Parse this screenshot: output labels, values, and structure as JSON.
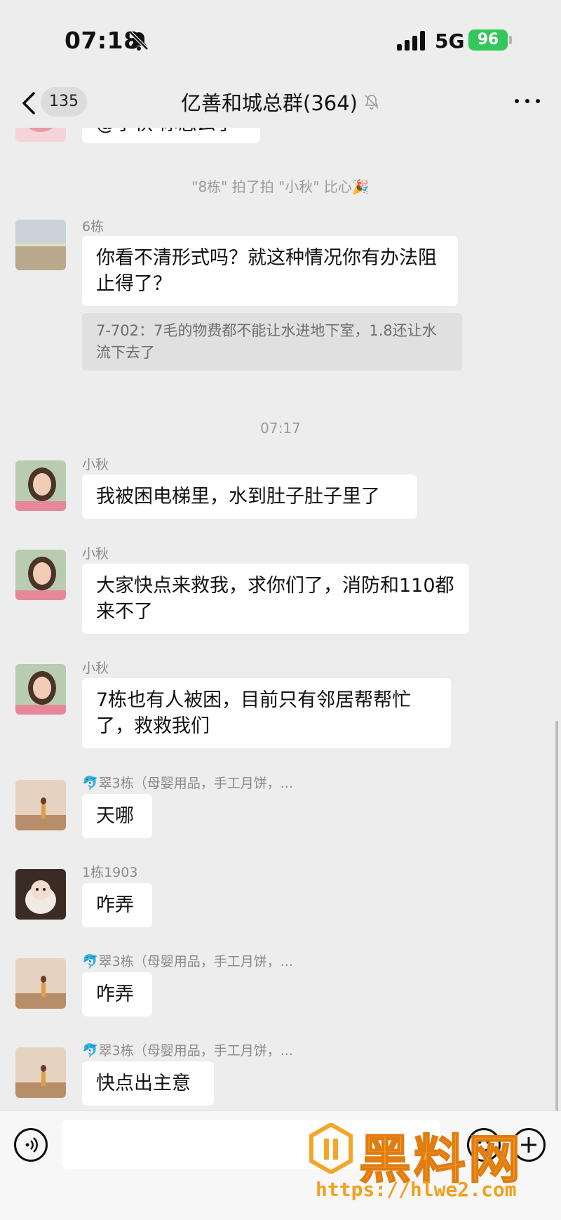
{
  "status_bar": {
    "time": "07:18",
    "network": "5G",
    "battery": "96"
  },
  "nav": {
    "unread_count": "135",
    "title": "亿善和城总群(364)"
  },
  "chat": {
    "partial_message": "@小秋 你怎么了",
    "pat_notice": "\"8栋\" 拍了拍 \"小秋\" 比心🎉",
    "timestamp": "07:17",
    "messages": [
      {
        "sender": "6栋",
        "text": "你看不清形式吗？就这种情况你有办法阻止得了？",
        "quote": "7-702：7毛的物费都不能让水进地下室，1.8还让水流下去了"
      },
      {
        "sender": "小秋",
        "text": "我被困电梯里，水到肚子肚子里了"
      },
      {
        "sender": "小秋",
        "text": "大家快点来救我，求你们了，消防和110都来不了"
      },
      {
        "sender": "小秋",
        "text": "7栋也有人被困，目前只有邻居帮帮忙了，救救我们"
      },
      {
        "sender": "🐬翠3栋（母婴用品，手工月饼，...",
        "text": "天哪"
      },
      {
        "sender": "1栋1903",
        "text": "咋弄"
      },
      {
        "sender": "🐬翠3栋（母婴用品，手工月饼，...",
        "text": "咋弄"
      },
      {
        "sender": "🐬翠3栋（母婴用品，手工月饼，...",
        "text": "快点出主意"
      }
    ]
  },
  "watermark": {
    "name": "黑料网",
    "url": "https://hlwe2.com"
  },
  "colors": {
    "background": "#ededed",
    "bubble": "#ffffff",
    "battery": "#35c759",
    "watermark": "#f4a62a"
  },
  "icons": [
    "bell-off-icon",
    "signal-icon",
    "battery-icon",
    "back-chevron-icon",
    "mute-icon",
    "more-icon",
    "voice-icon",
    "emoji-icon",
    "plus-icon"
  ]
}
